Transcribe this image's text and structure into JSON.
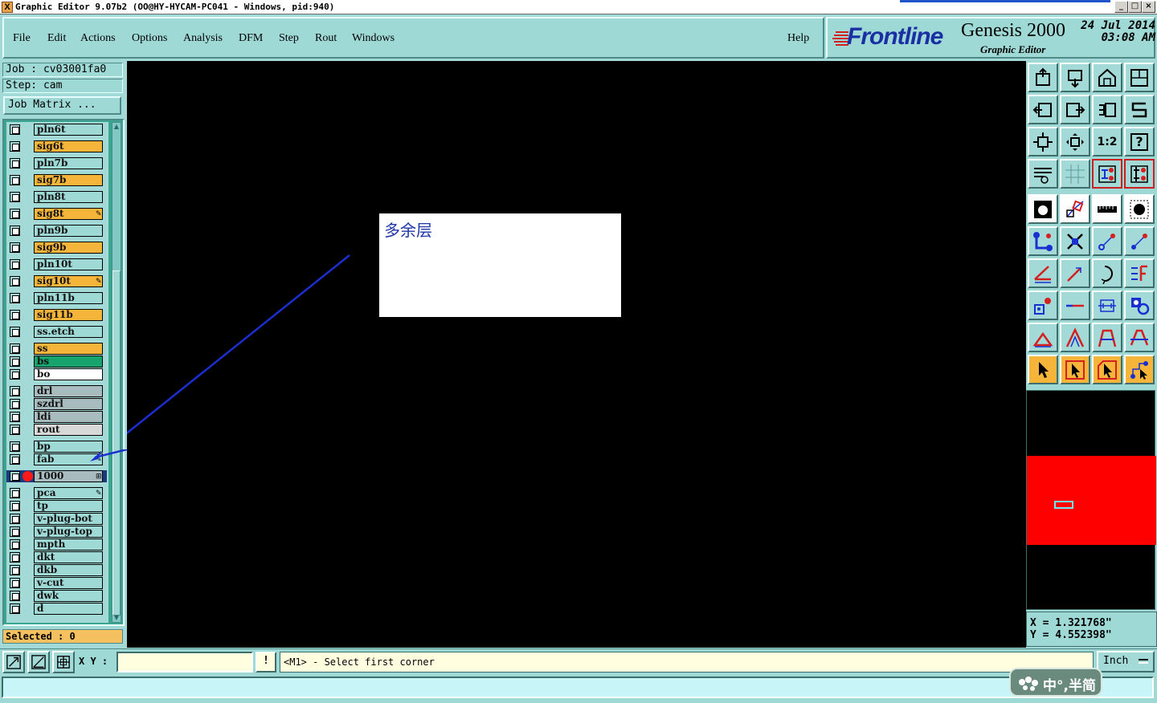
{
  "titlebar": {
    "title": "Graphic Editor 9.07b2  (OO@HY-HYCAM-PC041 - Windows, pid:940)",
    "icon_label": "X",
    "min_btn": "_",
    "max_btn": "□",
    "close_btn": "×"
  },
  "menubar": {
    "items": [
      "File",
      "Edit",
      "Actions",
      "Options",
      "Analysis",
      "DFM",
      "Step",
      "Rout",
      "Windows"
    ],
    "help": "Help"
  },
  "brand": {
    "logo": "Frontline",
    "product": "Genesis 2000",
    "subtitle": "Graphic Editor",
    "date": "24 Jul 2014",
    "time": "03:08 AM"
  },
  "job": {
    "job_label": "Job : cv03001fa0",
    "step_label": "Step: cam",
    "matrix_button": "Job Matrix ..."
  },
  "layers": [
    {
      "name": "pln6t",
      "color": "#9ed9d6",
      "flag": ""
    },
    {
      "name": "sig6t",
      "color": "#f5b53a",
      "flag": ""
    },
    {
      "name": "pln7b",
      "color": "#9ed9d6",
      "flag": ""
    },
    {
      "name": "sig7b",
      "color": "#f5b53a",
      "flag": ""
    },
    {
      "name": "pln8t",
      "color": "#9ed9d6",
      "flag": ""
    },
    {
      "name": "sig8t",
      "color": "#f5b53a",
      "flag": "✎"
    },
    {
      "name": "pln9b",
      "color": "#9ed9d6",
      "flag": ""
    },
    {
      "name": "sig9b",
      "color": "#f5b53a",
      "flag": ""
    },
    {
      "name": "pln10t",
      "color": "#9ed9d6",
      "flag": ""
    },
    {
      "name": "sig10t",
      "color": "#f5b53a",
      "flag": "✎"
    },
    {
      "name": "pln11b",
      "color": "#9ed9d6",
      "flag": ""
    },
    {
      "name": "sig11b",
      "color": "#f5b53a",
      "flag": ""
    },
    {
      "name": "ss.etch",
      "color": "#9ed9d6",
      "flag": ""
    },
    {
      "name": "ss",
      "color": "#f5b53a",
      "flag": ""
    },
    {
      "name": "bs",
      "color": "#16a36e",
      "flag": ""
    },
    {
      "name": "bo",
      "color": "#ffffff",
      "flag": ""
    },
    {
      "name": "drl",
      "color": "#a8bcc0",
      "flag": ""
    },
    {
      "name": "szdrl",
      "color": "#a8bcc0",
      "flag": ""
    },
    {
      "name": "ldi",
      "color": "#a8bcc0",
      "flag": ""
    },
    {
      "name": "rout",
      "color": "#d8d8d8",
      "flag": ""
    },
    {
      "name": "bp",
      "color": "#9ed9d6",
      "flag": ""
    },
    {
      "name": "fab",
      "color": "#9ed9d6",
      "flag": "✎"
    },
    {
      "name": "1000",
      "color": "#a8bcc0",
      "flag": "⊞"
    },
    {
      "name": "pca",
      "color": "#9ed9d6",
      "flag": "✎"
    },
    {
      "name": "tp",
      "color": "#9ed9d6",
      "flag": ""
    },
    {
      "name": "v-plug-bot",
      "color": "#9ed9d6",
      "flag": ""
    },
    {
      "name": "v-plug-top",
      "color": "#9ed9d6",
      "flag": ""
    },
    {
      "name": "mpth",
      "color": "#9ed9d6",
      "flag": ""
    },
    {
      "name": "dkt",
      "color": "#9ed9d6",
      "flag": ""
    },
    {
      "name": "dkb",
      "color": "#9ed9d6",
      "flag": ""
    },
    {
      "name": "v-cut",
      "color": "#9ed9d6",
      "flag": ""
    },
    {
      "name": "dwk",
      "color": "#9ed9d6",
      "flag": ""
    },
    {
      "name": "d",
      "color": "#9ed9d6",
      "flag": ""
    }
  ],
  "selected_label": "Selected : 0",
  "canvas": {
    "note_text": "多余层",
    "background": "#000000",
    "arrow_color": "#1a2fd0"
  },
  "tools": {
    "zoom_icons": [
      "zoom-fit-icon",
      "zoom-in-icon",
      "home-icon",
      "window-icon",
      "pan-left-icon",
      "pan-right-icon",
      "snap-icon",
      "redo-icon",
      "zoom-extents-icon",
      "zoom-center-icon",
      "ratio-label",
      "help-icon",
      "grid-settings-icon",
      "grid-icon",
      "layers-red-icon",
      "layers-red2-icon"
    ],
    "ratio_text": "1:2",
    "help_text": "?"
  },
  "coords": {
    "x_label": "X  =  1.321768\"",
    "y_label": "Y  =  4.552398\""
  },
  "bottom": {
    "xy_label": "X Y :",
    "xy_value": "",
    "bang": "!",
    "status": "<M1> - Select first corner",
    "units": "Inch"
  },
  "ime": {
    "text": "中°,半简"
  }
}
